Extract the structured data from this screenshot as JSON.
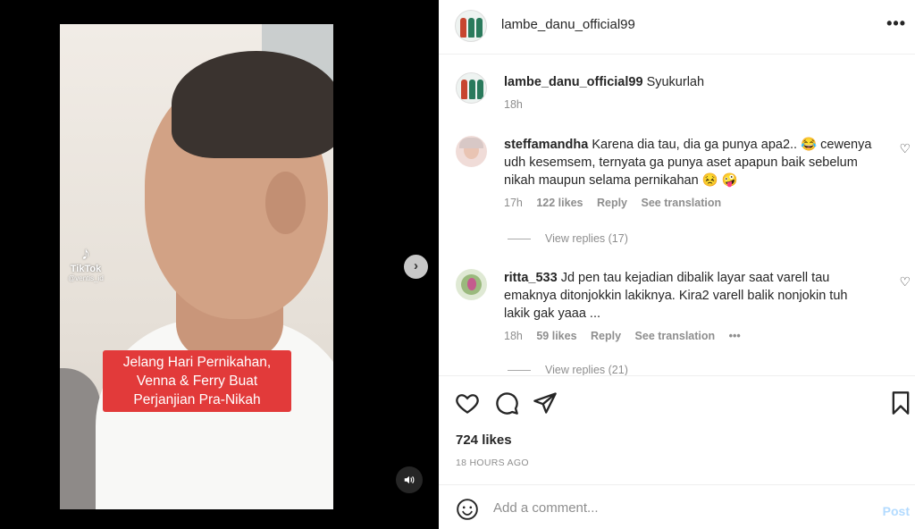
{
  "post": {
    "username": "lambe_danu_official99",
    "caption_text": "Syukurlah",
    "caption_age": "18h",
    "likes": "724 likes",
    "time_ago": "18 HOURS AGO"
  },
  "media": {
    "overlay_lines": [
      "Jelang Hari Pernikahan,",
      "Venna & Ferry Buat",
      "Perjanjian Pra-Nikah"
    ],
    "watermark": "TikTok",
    "watermark_handle": "@ventis_id"
  },
  "comments": [
    {
      "username": "steffamandha",
      "text": "Karena dia tau, dia ga punya apa2.. 😂 cewenya udh kesemsem, ternyata ga punya aset apapun baik sebelum nikah maupun selama pernikahan 😣 🤪",
      "age": "17h",
      "likes": "122 likes",
      "reply": "Reply",
      "translate": "See translation",
      "view_replies": "View replies (17)"
    },
    {
      "username": "ritta_533",
      "text": "Jd pen tau kejadian dibalik layar saat varell tau emaknya ditonjokkin lakiknya. Kira2 varell balik nonjokin tuh lakik gak yaaa ...",
      "age": "18h",
      "likes": "59 likes",
      "reply": "Reply",
      "translate": "See translation",
      "more": "•••",
      "view_replies": "View replies (21)"
    }
  ],
  "add_comment": {
    "placeholder": "Add a comment...",
    "post_label": "Post"
  },
  "icons": {
    "more": "more-options-icon",
    "next": "chevron-right-icon",
    "sound": "speaker-icon",
    "like": "heart-icon",
    "comment": "comment-icon",
    "share": "paper-plane-icon",
    "save": "bookmark-icon",
    "emoji": "emoji-icon"
  },
  "colors": {
    "caption_bg": "#e23a3a",
    "post_disabled": "#b3dbff",
    "secondary_text": "#8e8e8e"
  }
}
